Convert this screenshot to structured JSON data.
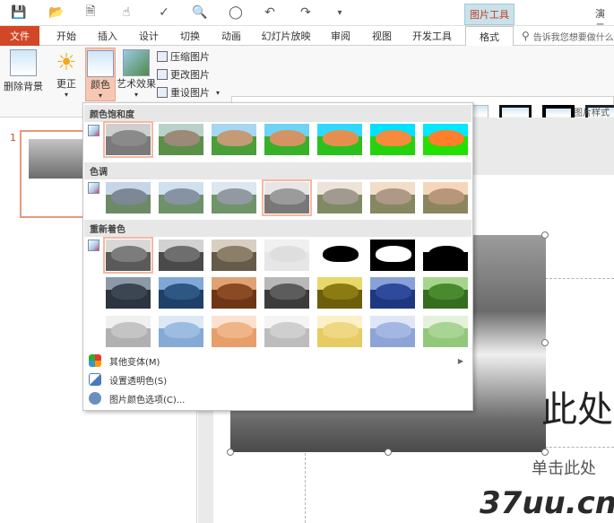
{
  "qat": {
    "icons": [
      "save-icon",
      "open-icon",
      "new-icon",
      "touch-icon",
      "spellcheck-icon",
      "find-icon",
      "screenshot-icon",
      "undo-icon",
      "redo-icon",
      "customize-icon"
    ],
    "context_tool_label": "图片工具",
    "app_title": "演示"
  },
  "tabs": [
    {
      "label": "文件"
    },
    {
      "label": "开始"
    },
    {
      "label": "插入"
    },
    {
      "label": "设计"
    },
    {
      "label": "切换"
    },
    {
      "label": "动画"
    },
    {
      "label": "幻灯片放映"
    },
    {
      "label": "审阅"
    },
    {
      "label": "视图"
    },
    {
      "label": "开发工具"
    },
    {
      "label": "格式"
    }
  ],
  "tell_me": "告诉我您想要做什么",
  "ribbon": {
    "remove_bg": "删除背景",
    "corrections": "更正",
    "color": "颜色",
    "artistic": "艺术效果",
    "compress": "压缩图片",
    "change_pic": "更改图片",
    "reset_pic": "重设图片",
    "styles_group": "图片样式"
  },
  "dropdown": {
    "saturation_label": "颜色饱和度",
    "tone_label": "色调",
    "recolor_label": "重新着色",
    "more_variations": "其他变体(M)",
    "set_transparent": "设置透明色(S)",
    "color_options": "图片颜色选项(C)..."
  },
  "slide": {
    "number": "1",
    "title": "此处",
    "subtitle": "单击此处"
  },
  "watermark": "37uu.cn",
  "swatches": {
    "saturation": [
      {
        "sky": "#cfcfcf",
        "hand": "#8a8a8a",
        "gnd": "#7a7a7a"
      },
      {
        "sky": "#b9d2c9",
        "hand": "#9b8a78",
        "gnd": "#5c8f48"
      },
      {
        "sky": "#a7d6f0",
        "hand": "#c49a77",
        "gnd": "#4a9f38"
      },
      {
        "sky": "#6ed3f5",
        "hand": "#d59363",
        "gnd": "#39b02a"
      },
      {
        "sky": "#30d8ff",
        "hand": "#e58f4f",
        "gnd": "#2bc01d"
      },
      {
        "sky": "#00e0ff",
        "hand": "#f78a3c",
        "gnd": "#25d20e"
      },
      {
        "sky": "#00e8ff",
        "hand": "#ff7f2a",
        "gnd": "#22e000"
      }
    ],
    "tone": [
      {
        "sky": "#c6d6e8",
        "hand": "#7d8896",
        "gnd": "#6d8a66"
      },
      {
        "sky": "#d0e0ef",
        "hand": "#8793a0",
        "gnd": "#6f916a"
      },
      {
        "sky": "#dde7f0",
        "hand": "#9299a2",
        "gnd": "#70946a"
      },
      {
        "sky": "#e6e6e6",
        "hand": "#9b9b9b",
        "gnd": "#787878"
      },
      {
        "sky": "#ede3d8",
        "hand": "#a39a8f",
        "gnd": "#7f8a63"
      },
      {
        "sky": "#f2ddc8",
        "hand": "#ad9985",
        "gnd": "#858860"
      },
      {
        "sky": "#f6d6bb",
        "hand": "#b7977b",
        "gnd": "#8b865d"
      }
    ],
    "recolor_row1": [
      {
        "sky": "#d8d8d8",
        "hand": "#7c7c7c",
        "gnd": "#5a5a5a"
      },
      {
        "sky": "#d2d2d2",
        "hand": "#6e6e6e",
        "gnd": "#4a4a4a"
      },
      {
        "sky": "#d8cfc2",
        "hand": "#8d7e6a",
        "gnd": "#665a49"
      },
      {
        "sky": "#f0f0f0",
        "hand": "#dedede",
        "gnd": "#e6e6e6"
      },
      {
        "sky": "#ffffff",
        "hand": "#000000",
        "gnd": "#ffffff"
      },
      {
        "sky": "#000000",
        "hand": "#ffffff",
        "gnd": "#000000"
      },
      {
        "sky": "#ffffff",
        "hand": "#000000",
        "gnd": "#000000"
      }
    ],
    "recolor_row2": [
      {
        "sky": "#8c9aa8",
        "hand": "#3c4652",
        "gnd": "#2c3440"
      },
      {
        "sky": "#7fa8d8",
        "hand": "#2f5784",
        "gnd": "#1f4068"
      },
      {
        "sky": "#e0a274",
        "hand": "#8a4a22",
        "gnd": "#6e3616"
      },
      {
        "sky": "#b8b8b8",
        "hand": "#5c5c5c",
        "gnd": "#3c3c3c"
      },
      {
        "sky": "#e8d86a",
        "hand": "#8c7a12",
        "gnd": "#6c5e0a"
      },
      {
        "sky": "#8aa0d8",
        "hand": "#2e4a9a",
        "gnd": "#1e3880"
      },
      {
        "sky": "#a6d48c",
        "hand": "#4a8a2e",
        "gnd": "#356e1e"
      }
    ],
    "recolor_row3": [
      {
        "sky": "#f0f0f0",
        "hand": "#c4c4c4",
        "gnd": "#b0b0b0"
      },
      {
        "sky": "#dce8f6",
        "hand": "#9cbce0",
        "gnd": "#86aad6"
      },
      {
        "sky": "#fbe2d0",
        "hand": "#efb488",
        "gnd": "#e89e6a"
      },
      {
        "sky": "#f4f4f4",
        "hand": "#cfcfcf",
        "gnd": "#bdbdbd"
      },
      {
        "sky": "#fbf0c8",
        "hand": "#efd884",
        "gnd": "#e6cc62"
      },
      {
        "sky": "#dfe6f6",
        "hand": "#a4b6e2",
        "gnd": "#8ea4d8"
      },
      {
        "sky": "#e4f2dc",
        "hand": "#a8d494",
        "gnd": "#92c87c"
      }
    ]
  }
}
